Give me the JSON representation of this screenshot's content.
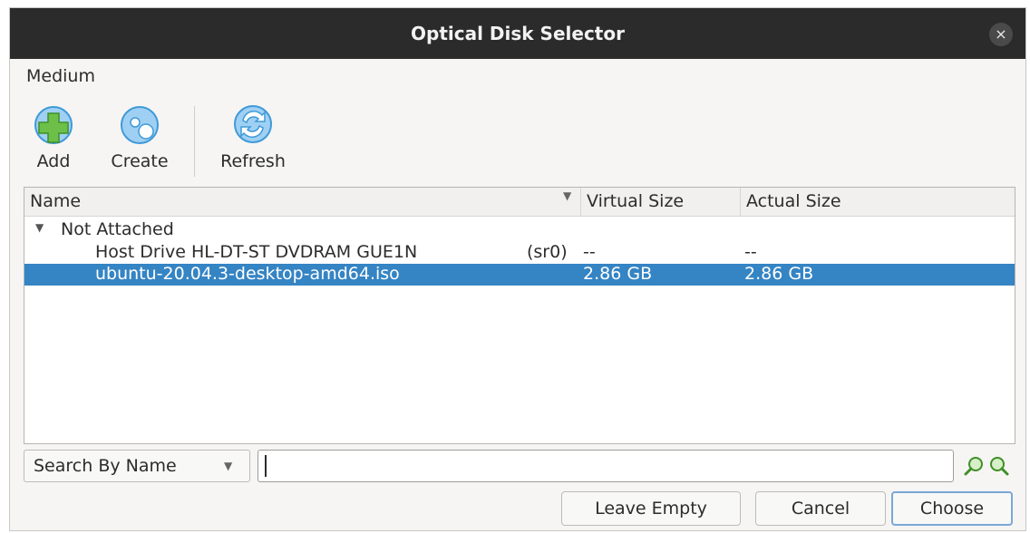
{
  "window": {
    "title": "Optical Disk Selector",
    "close_glyph": "×"
  },
  "menu": {
    "items": [
      "Medium"
    ]
  },
  "toolbar": {
    "add_label": "Add",
    "create_label": "Create",
    "refresh_label": "Refresh",
    "add_icon": "disk-add-icon",
    "create_icon": "disk-create-icon",
    "refresh_icon": "refresh-icon"
  },
  "table": {
    "columns": [
      "Name",
      "Virtual Size",
      "Actual Size"
    ],
    "group": {
      "label": "Not Attached",
      "expanded": true
    },
    "rows": [
      {
        "name": "Host Drive HL-DT-ST DVDRAM GUE1N",
        "device": "(sr0)",
        "virtual_size": "--",
        "actual_size": "--",
        "selected": false
      },
      {
        "name": "ubuntu-20.04.3-desktop-amd64.iso",
        "device": "",
        "virtual_size": "2.86 GB",
        "actual_size": "2.86 GB",
        "selected": true
      }
    ]
  },
  "search": {
    "mode": "Search By Name",
    "value": ""
  },
  "buttons": {
    "leave_empty": "Leave Empty",
    "cancel": "Cancel",
    "choose": "Choose"
  },
  "colors": {
    "titlebar": "#2b2b2b",
    "selection": "#3584c4",
    "icon_blue": "#3e9ad8",
    "icon_green": "#6cc04a"
  }
}
